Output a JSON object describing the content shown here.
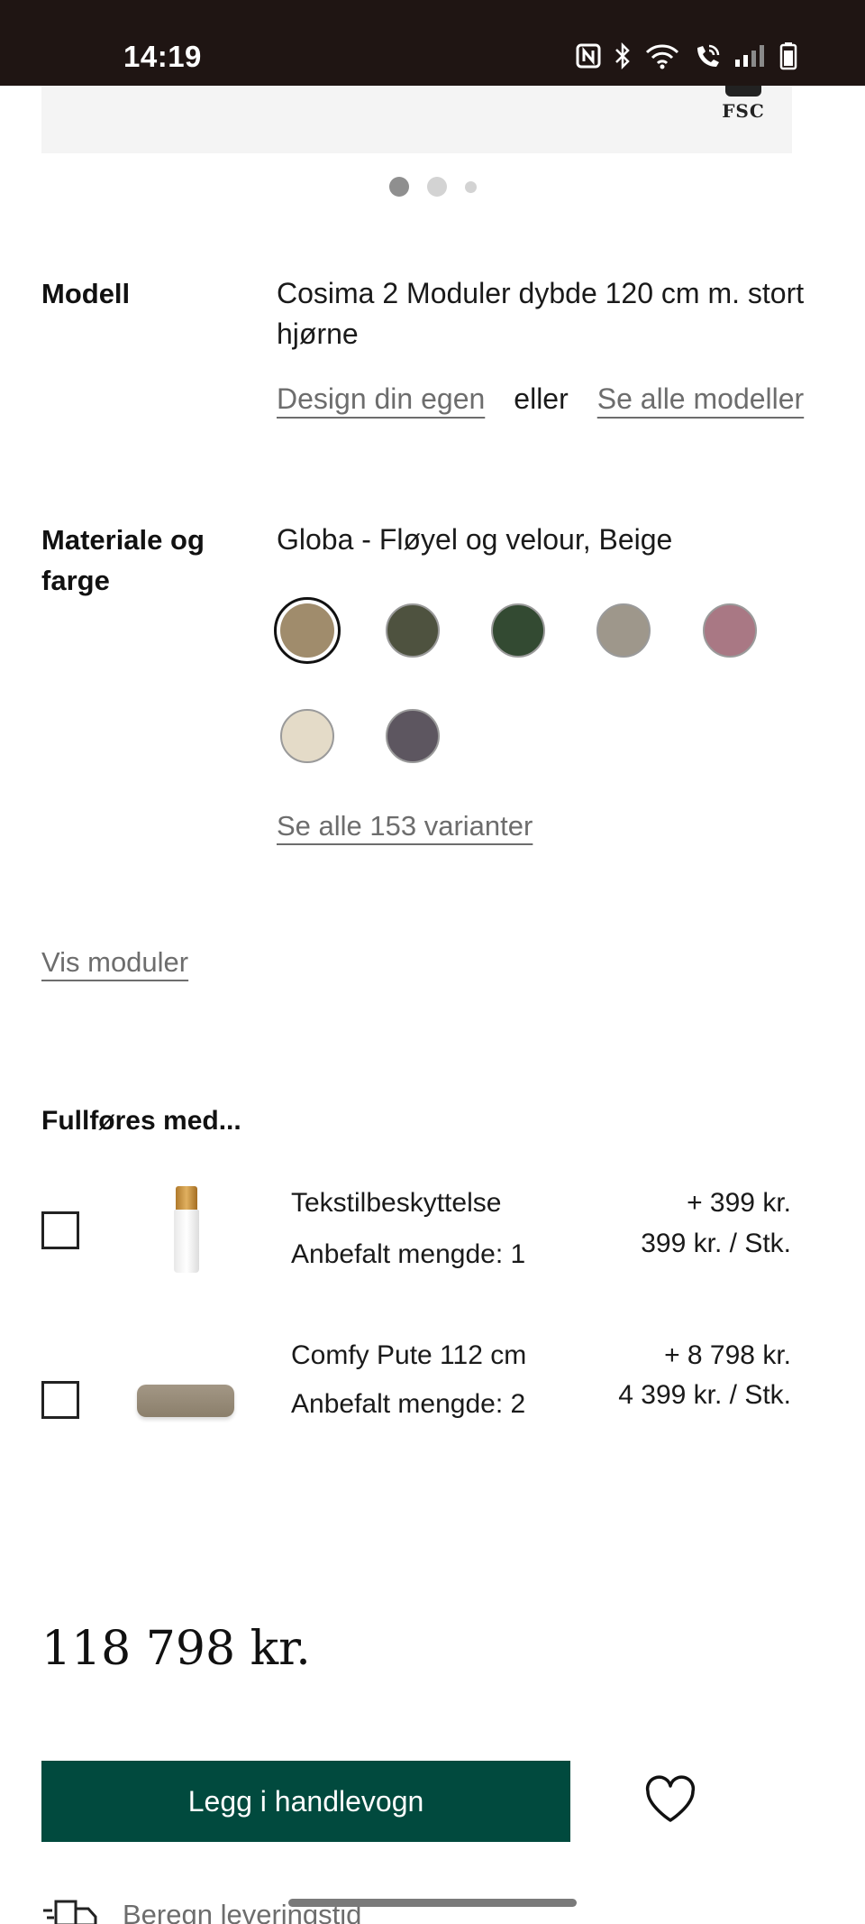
{
  "status_bar": {
    "time": "14:19",
    "icons": [
      "nfc-icon",
      "bluetooth-icon",
      "wifi-icon",
      "wifi-calling-icon",
      "signal-icon",
      "battery-icon"
    ]
  },
  "hero": {
    "logo_text": "FSC",
    "carousel_pages": 3,
    "active_page": 1
  },
  "model": {
    "label": "Modell",
    "value": "Cosima 2 Moduler dybde 120 cm m. stort hjørne",
    "design_link": "Design din egen",
    "or_text": "eller",
    "see_all_link": "Se alle modeller"
  },
  "material": {
    "label": "Materiale og farge",
    "value": "Globa - Fløyel og velour, Beige",
    "swatches": [
      {
        "name": "Beige",
        "color": "#a08c6c",
        "selected": true
      },
      {
        "name": "Olive",
        "color": "#4e523f"
      },
      {
        "name": "Dark green",
        "color": "#334a32"
      },
      {
        "name": "Grey beige",
        "color": "#9e978b"
      },
      {
        "name": "Rose",
        "color": "#a97884"
      },
      {
        "name": "Cream",
        "color": "#e4dbc8"
      },
      {
        "name": "Plum grey",
        "color": "#5d5660"
      }
    ],
    "see_all_variants": "Se alle 153 varianter"
  },
  "show_modules": "Vis moduler",
  "complete_with": {
    "title": "Fullføres med...",
    "items": [
      {
        "name": "Tekstilbeskyttelse",
        "recommended": "Anbefalt mengde: 1",
        "price_total": "+ 399 kr.",
        "price_unit": "399 kr. / Stk.",
        "checked": false
      },
      {
        "name": "Comfy Pute 112 cm",
        "recommended": "Anbefalt mengde: 2",
        "price_total": "+ 8 798 kr.",
        "price_unit": "4 399 kr. / Stk.",
        "checked": false
      }
    ]
  },
  "total_price": "118 798 kr.",
  "cart_button": "Legg i handlevogn",
  "delivery_link": "Beregn leveringstid",
  "colors": {
    "primary_button": "#014a3e",
    "status_bar": "#1f1513",
    "link_text": "#6d6d6d"
  }
}
